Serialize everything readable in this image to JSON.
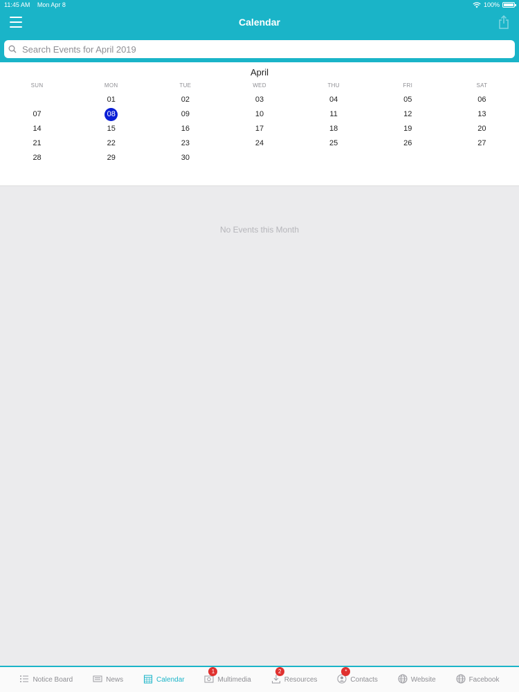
{
  "status_bar": {
    "time": "11:45 AM",
    "date": "Mon Apr 8",
    "battery": "100%"
  },
  "header": {
    "title": "Calendar"
  },
  "search": {
    "placeholder": "Search Events for April 2019",
    "value": ""
  },
  "calendar": {
    "month": "April",
    "weekdays": [
      "SUN",
      "MON",
      "TUE",
      "WED",
      "THU",
      "FRI",
      "SAT"
    ],
    "leading_blanks": 1,
    "days": [
      "01",
      "02",
      "03",
      "04",
      "05",
      "06",
      "07",
      "08",
      "09",
      "10",
      "11",
      "12",
      "13",
      "14",
      "15",
      "16",
      "17",
      "18",
      "19",
      "20",
      "21",
      "22",
      "23",
      "24",
      "25",
      "26",
      "27",
      "28",
      "29",
      "30"
    ],
    "selected_day": "08"
  },
  "empty_message": "No Events this Month",
  "tabs": [
    {
      "label": "Notice Board",
      "icon": "list-icon",
      "active": false,
      "badge": ""
    },
    {
      "label": "News",
      "icon": "newspaper-icon",
      "active": false,
      "badge": ""
    },
    {
      "label": "Calendar",
      "icon": "calendar-icon",
      "active": true,
      "badge": ""
    },
    {
      "label": "Multimedia",
      "icon": "multimedia-icon",
      "active": false,
      "badge": "1"
    },
    {
      "label": "Resources",
      "icon": "download-icon",
      "active": false,
      "badge": "2"
    },
    {
      "label": "Contacts",
      "icon": "contacts-icon",
      "active": false,
      "badge": "*"
    },
    {
      "label": "Website",
      "icon": "globe-icon",
      "active": false,
      "badge": ""
    },
    {
      "label": "Facebook",
      "icon": "globe-icon",
      "active": false,
      "badge": ""
    }
  ],
  "colors": {
    "accent": "#1ab4c8",
    "today": "#0a1fd6",
    "badge": "#e0312f",
    "background": "#ebebed"
  }
}
